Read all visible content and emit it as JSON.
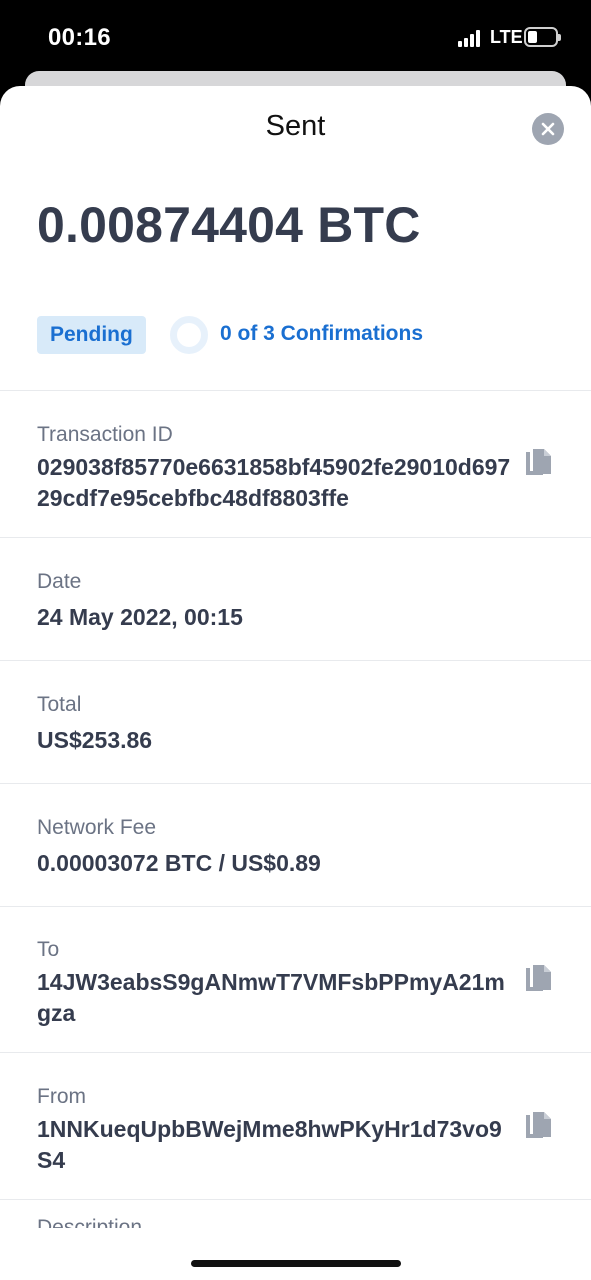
{
  "status_bar": {
    "time": "00:16",
    "network": "LTE"
  },
  "sheet": {
    "title": "Sent",
    "close_icon": "close-icon"
  },
  "transaction": {
    "amount": "0.00874404 BTC",
    "status": "Pending",
    "confirmations": "0 of 3 Confirmations"
  },
  "fields": {
    "transaction_id": {
      "label": "Transaction ID",
      "value": "029038f85770e6631858bf45902fe29010d69729cdf7e95cebfbc48df8803ffe"
    },
    "date": {
      "label": "Date",
      "value": "24 May 2022, 00:15"
    },
    "total": {
      "label": "Total",
      "value": "US$253.86"
    },
    "network_fee": {
      "label": "Network Fee",
      "value": "0.00003072 BTC / US$0.89"
    },
    "to": {
      "label": "To",
      "value": "14JW3eabsS9gANmwT7VMFsbPPmyA21mgza"
    },
    "from": {
      "label": "From",
      "value": "1NNKueqUpbBWejMme8hwPKyHr1d73vo9S4"
    },
    "description": {
      "label": "Description"
    }
  },
  "colors": {
    "accent": "#1a6fd1",
    "badge_bg": "#d8eaf9",
    "text_primary": "#353c4e",
    "text_secondary": "#6b7384"
  }
}
